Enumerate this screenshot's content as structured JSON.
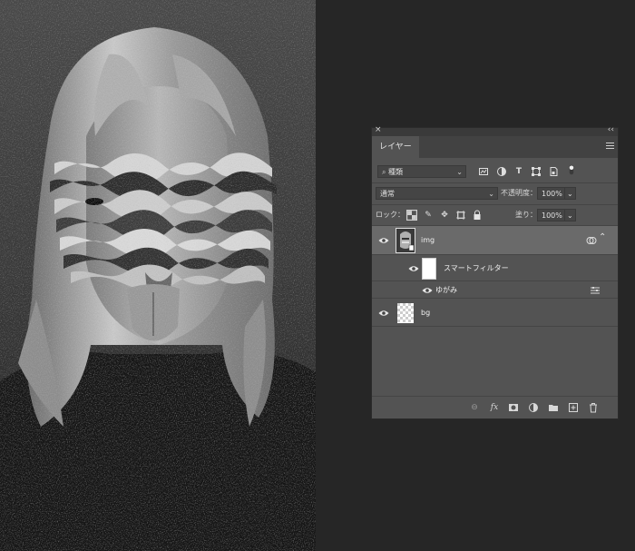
{
  "panel": {
    "tab_label": "レイヤー",
    "filter": {
      "kind": "種類"
    },
    "blend": {
      "mode": "通常",
      "opacity_label": "不透明度：",
      "opacity_value": "100%"
    },
    "lock": {
      "label": "ロック：",
      "fill_label": "塗り：",
      "fill_value": "100%"
    },
    "layers": [
      {
        "name": "img",
        "type": "smart-object",
        "visible": true,
        "selected": true
      },
      {
        "name": "スマートフィルター",
        "type": "smart-filter-mask",
        "visible": true
      },
      {
        "name": "ゆがみ",
        "type": "filter",
        "visible": true
      },
      {
        "name": "bg",
        "type": "empty-layer",
        "visible": true
      }
    ]
  },
  "colors": {
    "panel_bg": "#535353",
    "selected_row": "#6a6a6a",
    "workspace": "#262626"
  }
}
